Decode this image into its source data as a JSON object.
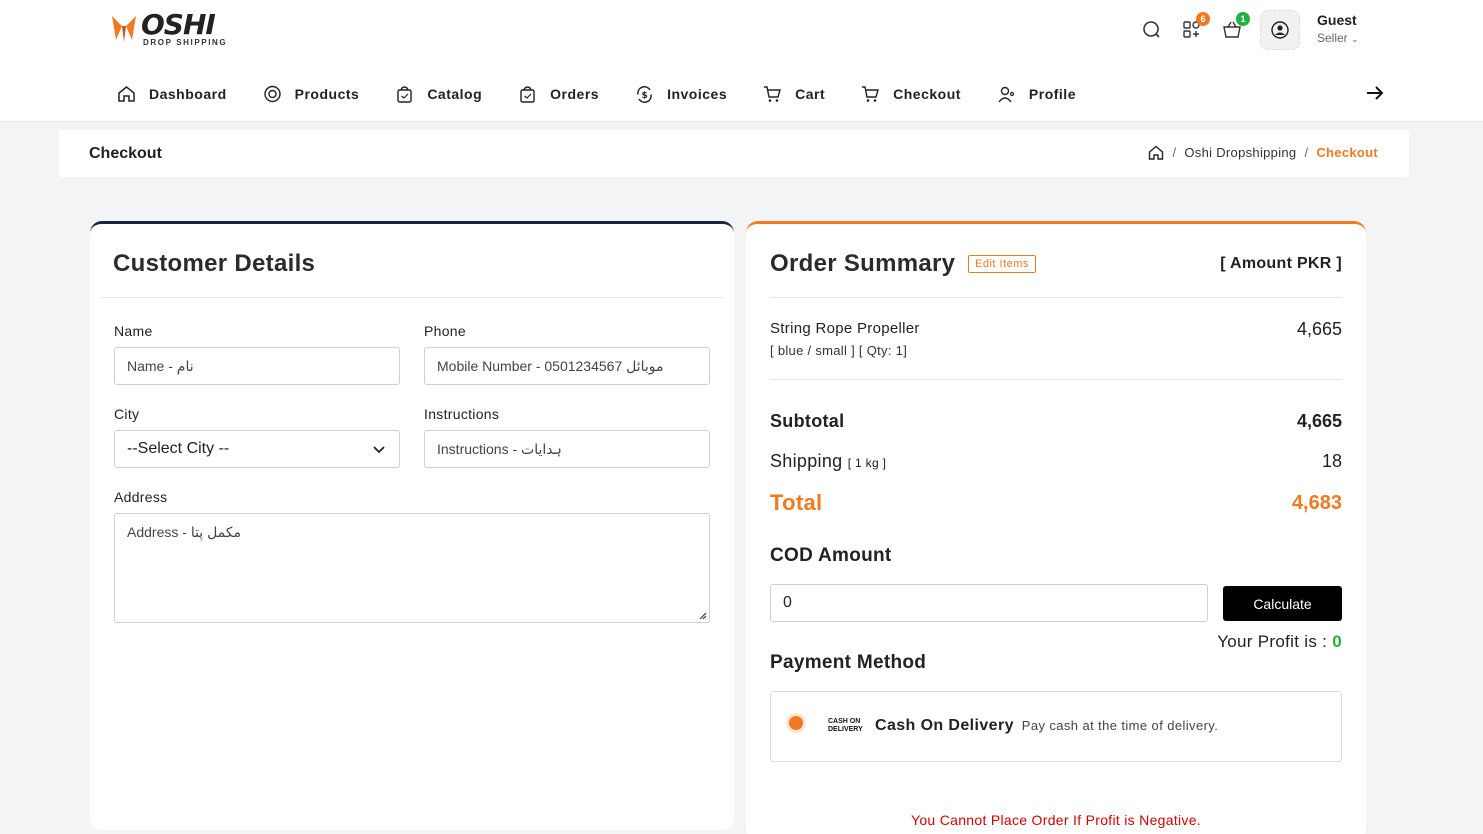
{
  "brand": {
    "name": "OSHI",
    "tagline": "DROP SHIPPING",
    "accent": "#f07a20",
    "dark": "#1b2440"
  },
  "header": {
    "icons": [
      {
        "name": "search-icon"
      },
      {
        "name": "apps-icon",
        "badge": "6",
        "badge_color": "#f07a20"
      },
      {
        "name": "basket-icon",
        "badge": "1",
        "badge_color": "#1fb141"
      }
    ],
    "user": {
      "name": "Guest",
      "role": "Seller"
    }
  },
  "nav": [
    {
      "label": "Dashboard",
      "icon": "home-icon"
    },
    {
      "label": "Products",
      "icon": "target-icon"
    },
    {
      "label": "Catalog",
      "icon": "bag-icon"
    },
    {
      "label": "Orders",
      "icon": "bag-check-icon"
    },
    {
      "label": "Invoices",
      "icon": "dollar-cycle-icon"
    },
    {
      "label": "Cart",
      "icon": "cart-icon"
    },
    {
      "label": "Checkout",
      "icon": "cart-icon"
    },
    {
      "label": "Profile",
      "icon": "user-icon"
    }
  ],
  "page": {
    "title": "Checkout",
    "breadcrumb": [
      "Oshi Dropshipping",
      "Checkout"
    ]
  },
  "customer": {
    "title": "Customer Details",
    "name_label": "Name",
    "name_placeholder": "Name - نام",
    "phone_label": "Phone",
    "phone_placeholder": "Mobile Number - 0501234567  موبائل",
    "city_label": "City",
    "city_value": "--Select City --",
    "instructions_label": "Instructions",
    "instructions_placeholder": "Instructions - ہدایات",
    "address_label": "Address",
    "address_placeholder": "Address - مکمل پتا"
  },
  "summary": {
    "title": "Order Summary",
    "edit_label": "Edit Items",
    "currency_label": "[ Amount PKR ]",
    "item": {
      "name": "String Rope Propeller",
      "meta": "[ blue / small ] [ Qty: 1]",
      "price": "4,665"
    },
    "subtotal_label": "Subtotal",
    "subtotal": "4,665",
    "shipping_label": "Shipping",
    "shipping_weight": "[ 1 kg ]",
    "shipping": "18",
    "total_label": "Total",
    "total": "4,683",
    "cod_label": "COD Amount",
    "cod_value": "0",
    "calculate_label": "Calculate",
    "profit_label": "Your Profit is :",
    "profit_value": "0",
    "payment_label": "Payment Method",
    "payment_logo_top": "CASH ON",
    "payment_logo_bottom": "DELIVERY",
    "payment_name": "Cash On Delivery",
    "payment_desc": "Pay cash at the time of delivery.",
    "warning": "You Cannot Place Order If Profit is Negative."
  }
}
